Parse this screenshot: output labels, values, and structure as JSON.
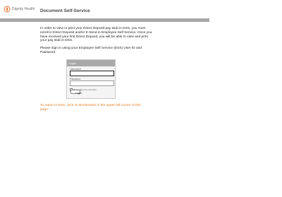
{
  "header": {
    "logo_text": "Dignity Health",
    "logo_icon": "dignity-health-logo-icon",
    "title": "Document Self-Service"
  },
  "intro": {
    "paragraph1": "In order to view or print your Direct Deposit pay stub in DSS, you must enroll in Direct Deposit and/or E-Send in Employee Self Service. Once you have received your first Direct Deposit, you will be able to view and print your pay stub in DSS.",
    "paragraph2": "Please sign in using your Employee Self Service (ESS) User ID and Password."
  },
  "login": {
    "header": "Login",
    "username_label": "Username",
    "password_label": "Password",
    "remember_label": "Remember me next time",
    "button_label": "Login"
  },
  "note": {
    "text": "To return to ESS, click on Bookmarks in the upper left corner of this page."
  },
  "colors": {
    "accent": "#e77b1f",
    "rule": "#a9a9a9",
    "logo": "#e8732a"
  }
}
